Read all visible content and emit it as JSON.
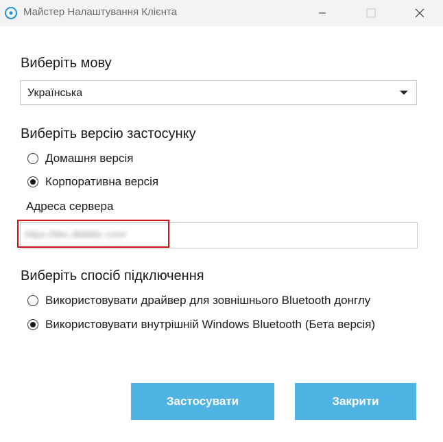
{
  "window": {
    "title": "Майстер Налаштування Клієнта"
  },
  "language": {
    "heading": "Виберіть мову",
    "selected": "Українська"
  },
  "version": {
    "heading": "Виберіть версію застосунку",
    "options": [
      {
        "label": "Домашня версія",
        "checked": false
      },
      {
        "label": "Корпоративна версія",
        "checked": true
      }
    ],
    "server_label": "Адреса сервера",
    "server_value": "https://bbc.dbbbbc.com/"
  },
  "connection": {
    "heading": "Виберіть спосіб підключення",
    "options": [
      {
        "label": "Використовувати драйвер для зовнішнього Bluetooth донглу",
        "checked": false
      },
      {
        "label": "Використовувати внутрішній Windows Bluetooth (Бета версія)",
        "checked": true
      }
    ]
  },
  "buttons": {
    "apply": "Застосувати",
    "close": "Закрити"
  },
  "colors": {
    "accent_button": "#4fb3e3",
    "highlight": "#d0121b",
    "app_icon": "#1e90d6"
  }
}
